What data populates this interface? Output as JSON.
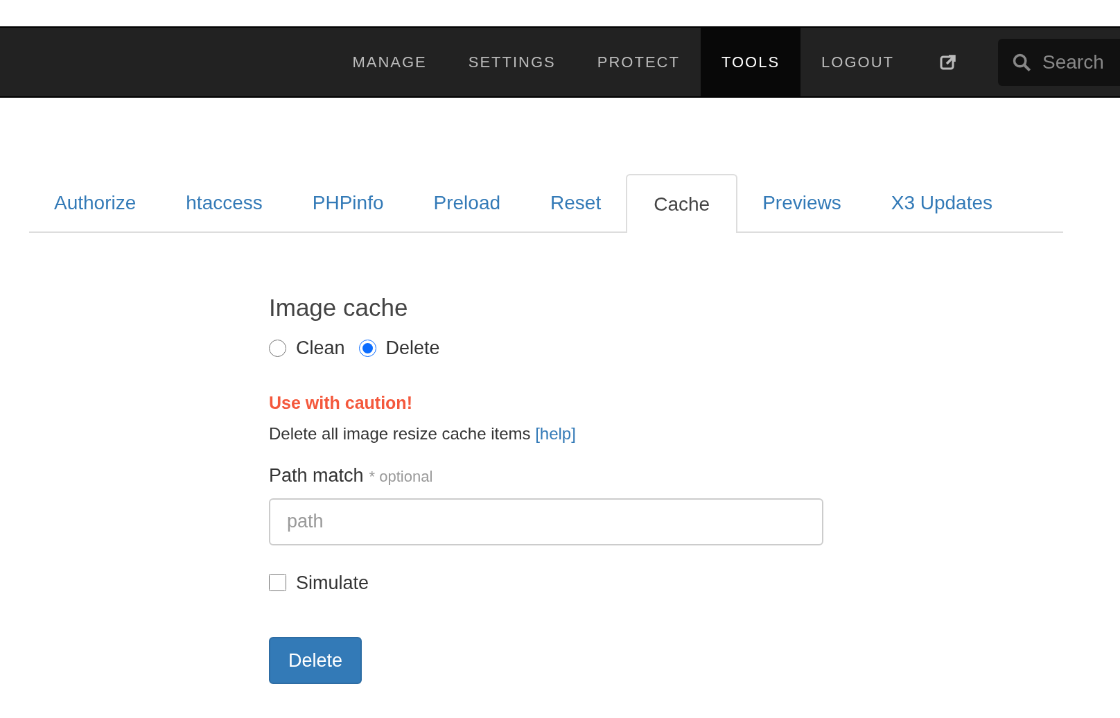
{
  "nav": {
    "items": [
      {
        "label": "MANAGE",
        "selected": false
      },
      {
        "label": "SETTINGS",
        "selected": false
      },
      {
        "label": "PROTECT",
        "selected": false
      },
      {
        "label": "TOOLS",
        "selected": true
      },
      {
        "label": "LOGOUT",
        "selected": false
      }
    ],
    "search": {
      "placeholder": "Search"
    }
  },
  "tabs": [
    {
      "label": "Authorize",
      "selected": false
    },
    {
      "label": "htaccess",
      "selected": false
    },
    {
      "label": "PHPinfo",
      "selected": false
    },
    {
      "label": "Preload",
      "selected": false
    },
    {
      "label": "Reset",
      "selected": false
    },
    {
      "label": "Cache",
      "selected": true
    },
    {
      "label": "Previews",
      "selected": false
    },
    {
      "label": "X3 Updates",
      "selected": false
    }
  ],
  "form": {
    "title": "Image cache",
    "modes": [
      {
        "label": "Clean",
        "selected": false
      },
      {
        "label": "Delete",
        "selected": true
      }
    ],
    "warning": "Use with caution!",
    "description": "Delete all image resize cache items",
    "help_link": "[help]",
    "path_label": "Path match",
    "path_note": "* optional",
    "path_placeholder": "path",
    "simulate": {
      "label": "Simulate",
      "checked": false
    },
    "submit": "Delete"
  }
}
